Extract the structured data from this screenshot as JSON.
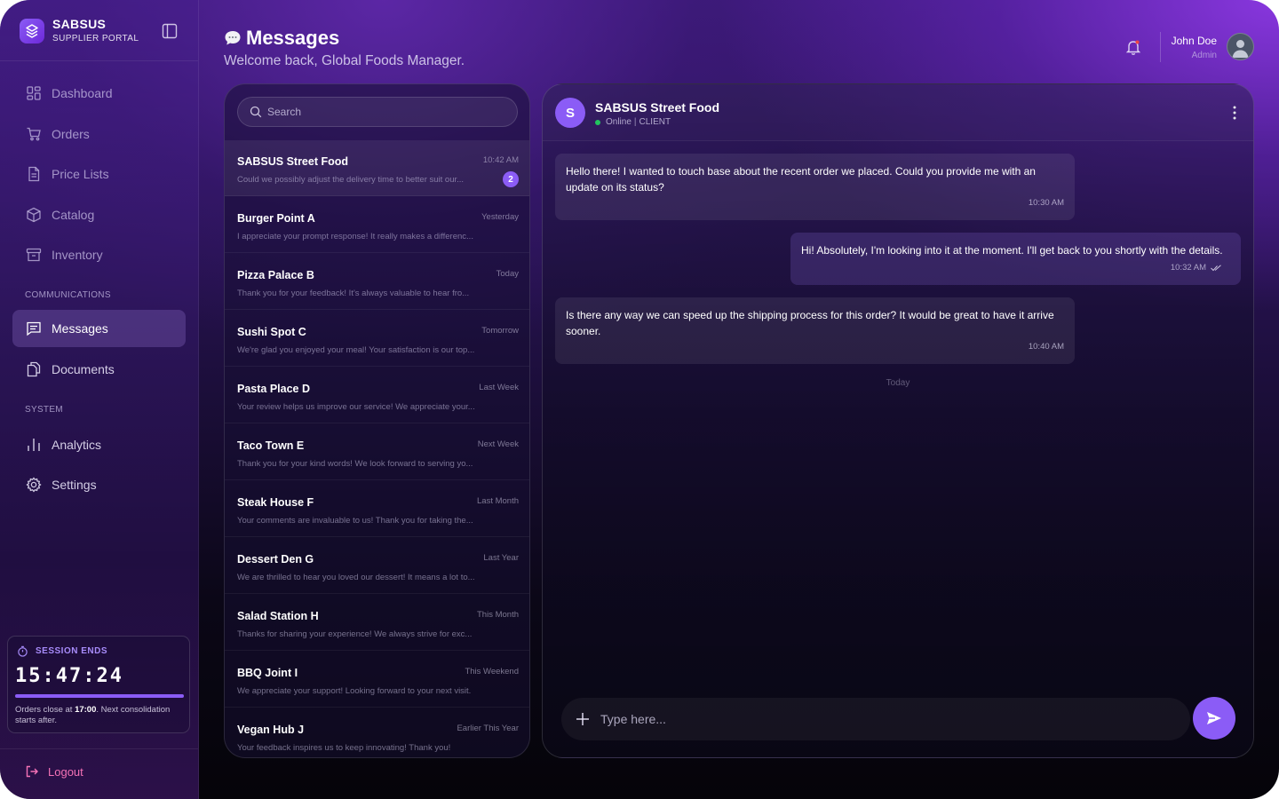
{
  "brand": {
    "name": "SABSUS",
    "subtitle": "SUPPLIER PORTAL"
  },
  "nav": {
    "items": [
      {
        "label": "Dashboard",
        "icon": "dashboard-icon"
      },
      {
        "label": "Orders",
        "icon": "cart-icon"
      },
      {
        "label": "Price Lists",
        "icon": "document-icon"
      },
      {
        "label": "Catalog",
        "icon": "box-icon"
      },
      {
        "label": "Inventory",
        "icon": "archive-icon"
      }
    ],
    "communications_label": "COMMUNICATIONS",
    "communications": [
      {
        "label": "Messages",
        "icon": "message-icon",
        "active": true
      },
      {
        "label": "Documents",
        "icon": "documents-icon"
      }
    ],
    "system_label": "SYSTEM",
    "system": [
      {
        "label": "Analytics",
        "icon": "analytics-icon"
      },
      {
        "label": "Settings",
        "icon": "gear-icon"
      }
    ]
  },
  "session": {
    "label": "SESSION ENDS",
    "time": "15:47:24",
    "progress": 1.0,
    "note_prefix": "Orders close at ",
    "note_time": "17:00",
    "note_suffix": ". Next consolidation starts after."
  },
  "logout_label": "Logout",
  "header": {
    "title": "Messages",
    "subtitle": "Welcome back, Global Foods Manager.",
    "user_name": "John Doe",
    "user_role": "Admin"
  },
  "search": {
    "placeholder": "Search"
  },
  "conversations": [
    {
      "name": "SABSUS Street Food",
      "time": "10:42 AM",
      "preview": "Could we possibly adjust the delivery time to better suit our...",
      "unread": "2",
      "selected": true
    },
    {
      "name": "Burger Point A",
      "time": "Yesterday",
      "preview": "I appreciate your prompt response! It really makes a differenc..."
    },
    {
      "name": "Pizza Palace B",
      "time": "Today",
      "preview": "Thank you for your feedback! It's always valuable to hear fro..."
    },
    {
      "name": "Sushi Spot C",
      "time": "Tomorrow",
      "preview": "We're glad you enjoyed your meal! Your satisfaction is our top..."
    },
    {
      "name": "Pasta Place D",
      "time": "Last Week",
      "preview": "Your review helps us improve our service! We appreciate your..."
    },
    {
      "name": "Taco Town E",
      "time": "Next Week",
      "preview": "Thank you for your kind words! We look forward to serving yo..."
    },
    {
      "name": "Steak House F",
      "time": "Last Month",
      "preview": "Your comments are invaluable to us! Thank you for taking the..."
    },
    {
      "name": "Dessert Den G",
      "time": "Last Year",
      "preview": "We are thrilled to hear you loved our dessert! It means a lot to..."
    },
    {
      "name": "Salad Station H",
      "time": "This Month",
      "preview": "Thanks for sharing your experience! We always strive for exc..."
    },
    {
      "name": "BBQ Joint I",
      "time": "This Weekend",
      "preview": "We appreciate your support! Looking forward to your next visit."
    },
    {
      "name": "Vegan Hub J",
      "time": "Earlier This Year",
      "preview": "Your feedback inspires us to keep innovating! Thank you!"
    }
  ],
  "chat": {
    "avatar_letter": "S",
    "name": "SABSUS Street Food",
    "status": "Online",
    "role": "CLIENT",
    "messages": [
      {
        "direction": "in",
        "text": "Hello there! I wanted to touch base about the recent order we placed. Could you provide me with an update on its status?",
        "time": "10:30 AM"
      },
      {
        "direction": "out",
        "text": "Hi! Absolutely, I'm looking into it at the moment. I'll get back to you shortly with the details.",
        "time": "10:32 AM",
        "read": true
      },
      {
        "direction": "in",
        "text": "Is there any way we can speed up the shipping process for this order? It would be great to have it arrive sooner.",
        "time": "10:40 AM"
      }
    ],
    "day_separator": "Today",
    "composer_placeholder": "Type here..."
  },
  "colors": {
    "accent": "#8b5cf6",
    "online": "#22c55e",
    "logout": "#f472b6"
  }
}
